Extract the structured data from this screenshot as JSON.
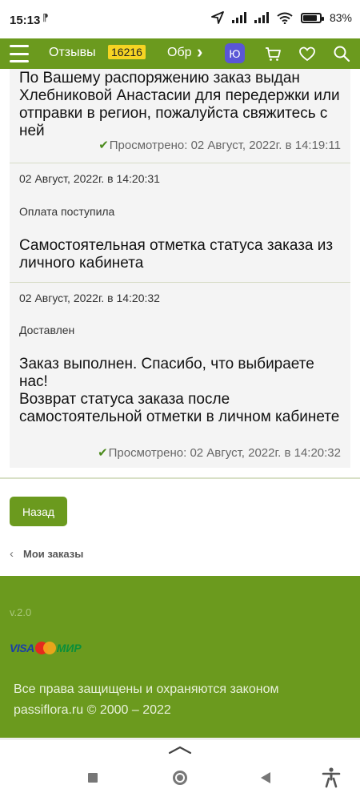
{
  "status_bar": {
    "time": "15:13",
    "battery_percent": "83%",
    "battery_level": 0.83
  },
  "navbar": {
    "reviews_label": "Отзывы",
    "reviews_count": "16216",
    "next_item_label": "Обр",
    "avatar_letter": "Ю",
    "accent_color": "#6b9a1e"
  },
  "history": {
    "entry_1": {
      "message": "По Вашему распоряжению заказ выдан Хлебниковой Анастасии для передержки или отправки в регион, пожалуйста свяжитесь с ней",
      "viewed": "Просмотрено: 02 Август, 2022г. в 14:19:11"
    },
    "entry_2": {
      "date": "02 Август, 2022г. в 14:20:31",
      "status": "Оплата поступила",
      "message": "Самостоятельная отметка статуса заказа из личного кабинета"
    },
    "entry_3": {
      "date": "02 Август, 2022г. в 14:20:32",
      "status": "Доставлен",
      "message_line_1": "Заказ выполнен. Спасибо, что выбираете нас!",
      "message_line_2": "Возврат статуса заказа после самостоятельной отметки в личном кабинете",
      "viewed": "Просмотрено: 02 Август, 2022г. в 14:20:32"
    }
  },
  "actions": {
    "back_button": "Назад",
    "breadcrumb_label": "Мои заказы"
  },
  "footer": {
    "version": "v.2.0",
    "visa_logo": "VISA",
    "mir_logo": "МИР",
    "rights_line_1": "Все права защищены и охраняются законом",
    "rights_line_2": "passiflora.ru © 2000 – 2022"
  }
}
